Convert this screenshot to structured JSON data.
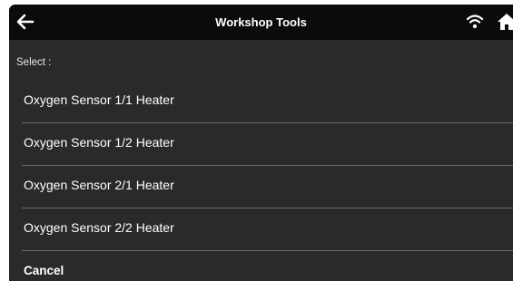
{
  "header": {
    "title": "Workshop Tools",
    "icons": [
      "arrow-left-icon",
      "wifi-icon",
      "home-icon"
    ]
  },
  "dialog": {
    "prompt": "Select :",
    "options": [
      "Oxygen Sensor 1/1 Heater",
      "Oxygen Sensor 1/2 Heater",
      "Oxygen Sensor 2/1 Heater",
      "Oxygen Sensor 2/2 Heater"
    ],
    "cancel_label": "Cancel"
  },
  "colors": {
    "topbar": "#0b0b0b",
    "background": "#2a2a2a",
    "separator": "#6b6b6b",
    "text": "#ffffff"
  }
}
